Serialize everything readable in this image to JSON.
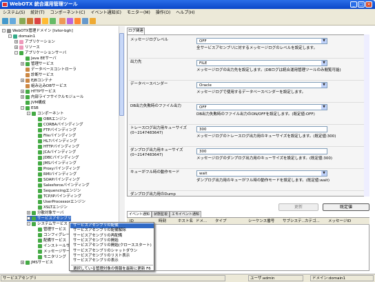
{
  "window": {
    "title": "WebOTX 統合運用管理ツール"
  },
  "menu": [
    "システム(S)",
    "統計(T)",
    "コンポーネント(C)",
    "イベント通知(E)",
    "モニター(M)",
    "操作(O)",
    "ヘルプ(H)"
  ],
  "tree": [
    {
      "label": "WebOTX管理ドメイン [tvtor-bgh]",
      "indent": 0,
      "exp": "-",
      "color": "#888"
    },
    {
      "label": "domain1",
      "indent": 1,
      "exp": "-",
      "color": "#3a8"
    },
    {
      "label": "アプリケーション",
      "indent": 2,
      "exp": "+",
      "color": "#e9b"
    },
    {
      "label": "リソース",
      "indent": 2,
      "exp": "+",
      "color": "#e9b"
    },
    {
      "label": "アプリケーションサーバ",
      "indent": 2,
      "exp": "-",
      "color": "#4a4"
    },
    {
      "label": "Java EEサーバ",
      "indent": 3,
      "exp": "",
      "color": "#4a4"
    },
    {
      "label": "管理サービス",
      "indent": 3,
      "exp": "+",
      "color": "#4a4"
    },
    {
      "label": "データベースコントローラ",
      "indent": 3,
      "exp": "",
      "color": "#c84"
    },
    {
      "label": "診断サービス",
      "indent": 3,
      "exp": "",
      "color": "#c84"
    },
    {
      "label": "EJBコンテナ",
      "indent": 3,
      "exp": "+",
      "color": "#c84"
    },
    {
      "label": "組み込みDBサービス",
      "indent": 3,
      "exp": "",
      "color": "#c84"
    },
    {
      "label": "HTTPサービス",
      "indent": 3,
      "exp": "+",
      "color": "#4a4"
    },
    {
      "label": "内部ライフサイクルモジュール",
      "indent": 3,
      "exp": "+",
      "color": "#4a4"
    },
    {
      "label": "JVM構成",
      "indent": 3,
      "exp": "",
      "color": "#4a4"
    },
    {
      "label": "ESB",
      "indent": 3,
      "exp": "-",
      "color": "#4a4"
    },
    {
      "label": "コンポーネント",
      "indent": 4,
      "exp": "-",
      "color": "#4a4"
    },
    {
      "label": "OBRエンジン",
      "indent": 5,
      "exp": "",
      "color": "#4a4"
    },
    {
      "label": "CORBAバインディング",
      "indent": 5,
      "exp": "",
      "color": "#4a4"
    },
    {
      "label": "FTPバインディング",
      "indent": 5,
      "exp": "",
      "color": "#4a4"
    },
    {
      "label": "Fileバインディング",
      "indent": 5,
      "exp": "",
      "color": "#4a4"
    },
    {
      "label": "HL7バインディング",
      "indent": 5,
      "exp": "",
      "color": "#4a4"
    },
    {
      "label": "HTTPバインディング",
      "indent": 5,
      "exp": "",
      "color": "#4a4"
    },
    {
      "label": "JCAバインディング",
      "indent": 5,
      "exp": "",
      "color": "#4a4"
    },
    {
      "label": "JDBCバインディング",
      "indent": 5,
      "exp": "",
      "color": "#4a4"
    },
    {
      "label": "JMSバインディング",
      "indent": 5,
      "exp": "",
      "color": "#4a4"
    },
    {
      "label": "Proxyバインディング",
      "indent": 5,
      "exp": "",
      "color": "#4a4"
    },
    {
      "label": "RMIバインディング",
      "indent": 5,
      "exp": "",
      "color": "#4a4"
    },
    {
      "label": "SOAPバインディング",
      "indent": 5,
      "exp": "",
      "color": "#4a4"
    },
    {
      "label": "Salesforceバインディング",
      "indent": 5,
      "exp": "",
      "color": "#4a4"
    },
    {
      "label": "Sequencingエンジン",
      "indent": 5,
      "exp": "",
      "color": "#4a4"
    },
    {
      "label": "TCP/IPバインディング",
      "indent": 5,
      "exp": "",
      "color": "#4a4"
    },
    {
      "label": "UserProcessorエンジン",
      "indent": 5,
      "exp": "",
      "color": "#4a4"
    },
    {
      "label": "XSLTエンジン",
      "indent": 5,
      "exp": "",
      "color": "#4a4"
    },
    {
      "label": "分散対象サーバ",
      "indent": 4,
      "exp": "+",
      "color": "#4a4"
    },
    {
      "label": "サービスアセンブリ",
      "indent": 4,
      "exp": "-",
      "color": "#4a4",
      "selected": true
    },
    {
      "label": "システムサービス",
      "indent": 4,
      "exp": "-",
      "color": "#4a4"
    },
    {
      "label": "管理サービス",
      "indent": 5,
      "exp": "",
      "color": "#4a4"
    },
    {
      "label": "コンフィグレーション",
      "indent": 5,
      "exp": "",
      "color": "#4a4"
    },
    {
      "label": "配備サービス",
      "indent": 5,
      "exp": "",
      "color": "#4a4"
    },
    {
      "label": "インストールサービス",
      "indent": 5,
      "exp": "",
      "color": "#4a4"
    },
    {
      "label": "メッセージサービス",
      "indent": 5,
      "exp": "",
      "color": "#4a4"
    },
    {
      "label": "モニタリング",
      "indent": 5,
      "exp": "",
      "color": "#4a4"
    },
    {
      "label": "JMSサービス",
      "indent": 3,
      "exp": "+",
      "color": "#4a4"
    }
  ],
  "right_tab": "ログ関連",
  "props": [
    {
      "label": "メッセージログレベル",
      "value": "OFF",
      "desc": "全サービスアセンブリに対するメッセージログのレベルを設定します。",
      "dropdown": true
    },
    {
      "label": "出力先",
      "value": "FILE",
      "desc": "メッセージログの出力先を設定します。(DBログは統合運用管理ツールのみ閲覧可能)",
      "dropdown": true
    },
    {
      "label": "データベースベンダー",
      "value": "Oracle",
      "desc": "メッセージログで使用するデータベースベンダーを設定します。",
      "dropdown": true
    },
    {
      "label": "DB出力失敗時のファイル出力",
      "value": "OFF",
      "desc": "DB出力失敗時のファイル出力のON/OFFを設定します。(既定値:OFF)",
      "dropdown": true
    },
    {
      "label": "トレースログ出力用キューサイズ(0~2147483647)",
      "value": "300",
      "desc": "メッセージログのトレースログ出力用のキューサイズを設定します。(既定値:300)",
      "dropdown": false
    },
    {
      "label": "ダンプログ出力用キューサイズ(0~2147483647)",
      "value": "300",
      "desc": "メッセージログのダンプログ出力用のキューサイズを設定します。(既定値:300)",
      "dropdown": false
    },
    {
      "label": "キューがフル時の動作モード",
      "value": "wait",
      "desc": "ダンプログ出力用のキューがフル時の動作モードを設定します。(既定値:wait)",
      "dropdown": true
    }
  ],
  "props_cut_label": "ダンプログ出力用のDump",
  "buttons": {
    "update": "更新",
    "default": "既定値"
  },
  "bottom_tabs": [
    "イベント通知",
    "状態監視",
    "エモイベント通知"
  ],
  "table_headers": [
    "ID",
    "時刻",
    "ホスト名",
    "ドメ...",
    "タイプ",
    "シーケンス番号",
    "サブシステ...",
    "カテゴ...",
    "メッセージID"
  ],
  "context_menu": [
    "サービスアセンブリの配備",
    "サービスアセンブリの配備解除",
    "サービスアセンブリの再配備",
    "サービスアセンブリの開始",
    "サービスアセンブリの開始(クローススタート)",
    "サービスアセンブリのシャットダウン",
    "サービスアセンブリのリスト表示",
    "サービスアセンブリの表示",
    "",
    "選択している管理対象の情報を最新に更新  F6"
  ],
  "status": {
    "left": "サービスアセンブリ",
    "user": "ユーザ:admin",
    "domain": "ドメイン:domain1"
  },
  "colors": {
    "titlebar": "#0a46c8",
    "selection": "#316ac5"
  }
}
